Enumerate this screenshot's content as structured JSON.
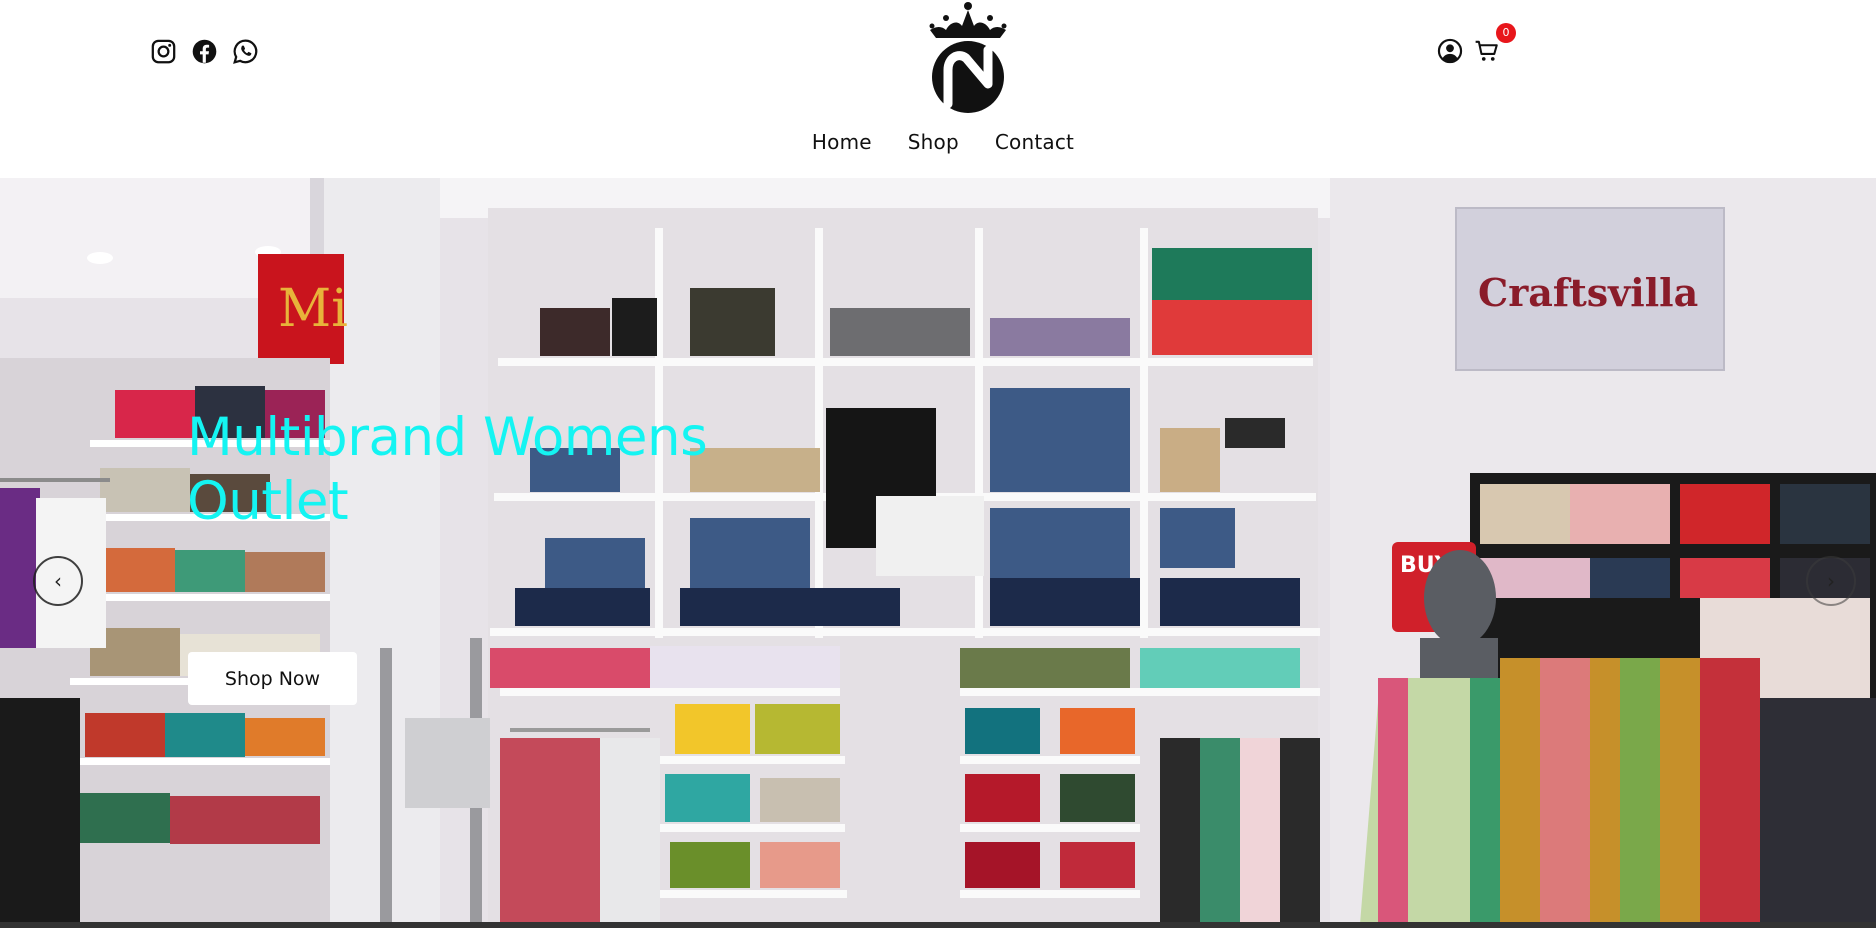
{
  "header": {
    "social": [
      {
        "name": "instagram-icon"
      },
      {
        "name": "facebook-icon"
      },
      {
        "name": "whatsapp-icon"
      }
    ],
    "logo_alt": "Brand crown N logo",
    "nav": [
      {
        "label": "Home"
      },
      {
        "label": "Shop"
      },
      {
        "label": "Contact"
      }
    ],
    "cart_count": "0"
  },
  "hero": {
    "title": "Multibrand Womens Outlet",
    "cta_label": "Shop Now",
    "prev_icon": "‹",
    "next_icon": "›",
    "scene_text": {
      "store_sign": "Craftsvilla",
      "side_sign": "Mi",
      "offer_sign": "BUY 2 GET FREE"
    }
  },
  "colors": {
    "title": "#14f4f2",
    "badge": "#e8161b",
    "button_bg": "#ffffff"
  }
}
